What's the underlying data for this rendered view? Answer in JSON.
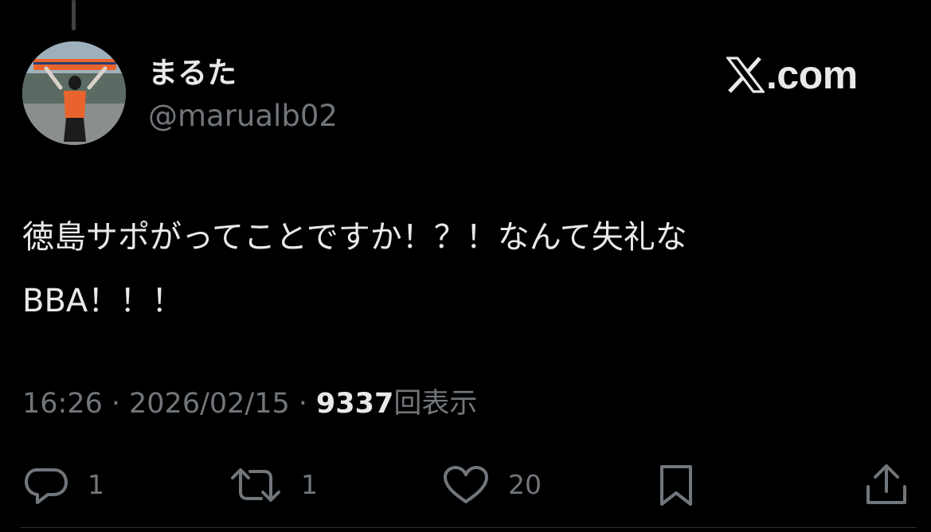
{
  "author": {
    "display_name": "まるた",
    "handle": "@marualb02"
  },
  "watermark": {
    "text": ".com",
    "logo_icon": "x-logo-icon"
  },
  "tweet": {
    "lines": [
      "徳島サポがってことですか！？！なんて失礼な",
      "BBA！！！"
    ]
  },
  "meta": {
    "time": "16:26",
    "separator": "·",
    "date": "2026/02/15",
    "views_count": "9337",
    "views_label": "回表示"
  },
  "actions": {
    "reply": {
      "icon": "reply-icon",
      "count": "1"
    },
    "repost": {
      "icon": "repost-icon",
      "count": "1"
    },
    "like": {
      "icon": "heart-icon",
      "count": "20"
    },
    "bookmark": {
      "icon": "bookmark-icon"
    },
    "share": {
      "icon": "share-icon"
    }
  },
  "colors": {
    "background": "#000000",
    "primary_text": "#e7e9ea",
    "secondary_text": "#71767b",
    "avatar_accent": "#e8642c"
  }
}
